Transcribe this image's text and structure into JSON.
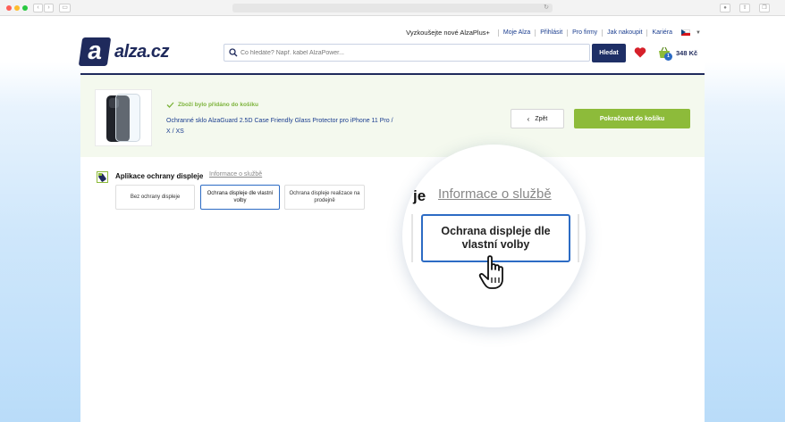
{
  "browser": {
    "nav_back": "‹",
    "nav_forward": "›",
    "reload": "↻"
  },
  "header": {
    "logo_letter": "a",
    "logo_text": "alza.cz",
    "promo": "Vyzkoušejte nové AlzaPlus+",
    "links": [
      "Moje Alza",
      "Přihlásit",
      "Pro firmy",
      "Jak nakoupit",
      "Kariéra"
    ],
    "search_placeholder": "Co hledáte? Např. kabel AlzaPower...",
    "search_button": "Hledat",
    "basket_count": "1",
    "basket_price": "348 Kč",
    "accent_color": "#1f2a5c"
  },
  "added": {
    "status": "Zboží bylo přidáno do košíku",
    "product_title": "Ochranné sklo AlzaGuard 2.5D Case Friendly Glass Protector pro iPhone 11 Pro / X / XS",
    "back_label": "Zpět",
    "continue_label": "Pokračovat do košíku",
    "success_color": "#8dbb3a"
  },
  "service": {
    "title": "Aplikace ochrany displeje",
    "info_link": "Informace o službě",
    "options": [
      {
        "label": "Bez ochrany displeje",
        "selected": false
      },
      {
        "label": "Ochrana displeje dle vlastní volby",
        "selected": true
      },
      {
        "label": "Ochrana displeje realizace na prodejně",
        "selected": false
      }
    ]
  },
  "magnifier": {
    "fragment": "je",
    "info_link": "Informace o službě",
    "option_label": "Ochrana displeje dle vlastní volby"
  }
}
